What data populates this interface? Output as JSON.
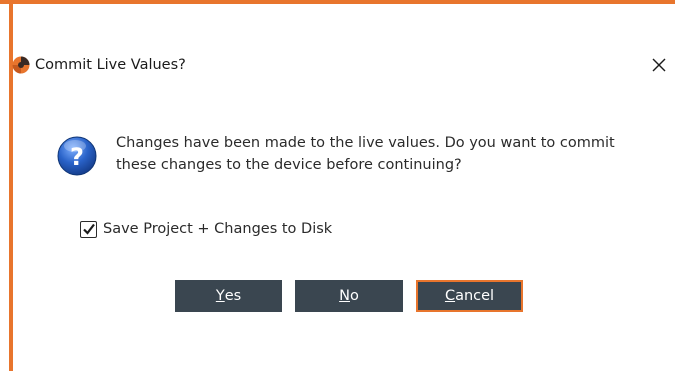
{
  "window": {
    "title": "Commit Live Values?",
    "close_icon": "close-icon",
    "app_icon": "app-logo-icon",
    "accent_color": "#E8752D"
  },
  "message": {
    "icon": "question-icon",
    "text": "Changes have been made to the live values. Do you want to commit these changes to the device before continuing?"
  },
  "options": {
    "save_checkbox_label": "Save Project + Changes to Disk",
    "save_checkbox_checked": true
  },
  "buttons": {
    "yes_mnemonic": "Y",
    "yes_rest": "es",
    "no_mnemonic": "N",
    "no_rest": "o",
    "cancel_mnemonic": "C",
    "cancel_rest": "ancel",
    "button_color": "#3A4650"
  }
}
